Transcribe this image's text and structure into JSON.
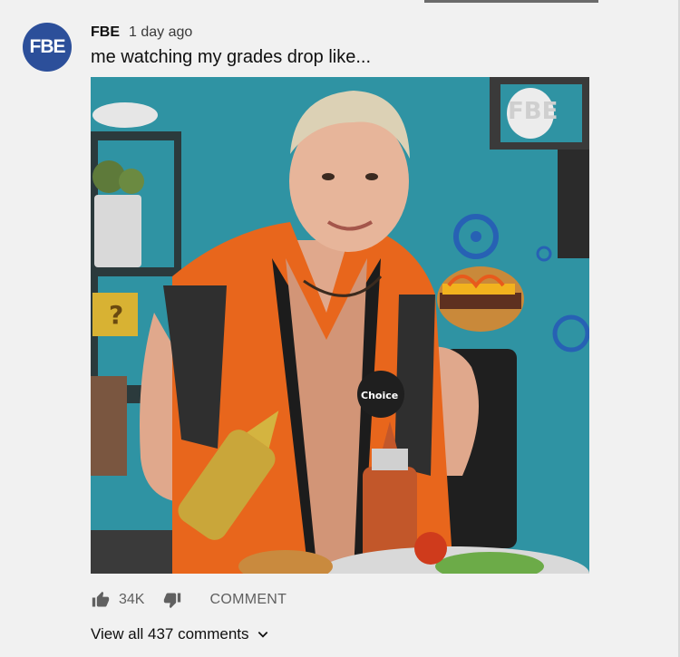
{
  "post": {
    "avatar_text": "FBE",
    "channel": "FBE",
    "time": "1 day ago",
    "text": "me watching my grades drop like...",
    "image": {
      "description_icon": "photo-image",
      "logo_text": "FBE",
      "shirt_text": "Choice"
    },
    "likes": "34K",
    "comment_label": "COMMENT",
    "view_comments": "View all 437 comments"
  },
  "colors": {
    "background": "#f1f1f1",
    "avatar": "#2c4f9a",
    "wall": "#2f93a3",
    "jacket": "#e8661c",
    "muted_text": "#606060"
  }
}
